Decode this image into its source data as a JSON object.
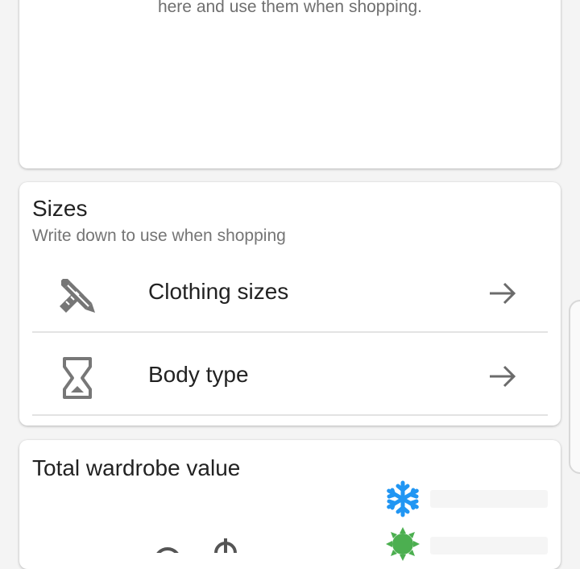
{
  "intro": {
    "text": "here and use them when shopping."
  },
  "sizes": {
    "title": "Sizes",
    "subtitle": "Write down to use when shopping",
    "items": [
      {
        "label": "Clothing sizes",
        "icon": "pencil-ruler-icon",
        "arrow_icon": "arrow-right-icon"
      },
      {
        "label": "Body type",
        "icon": "hourglass-icon",
        "arrow_icon": "arrow-right-icon"
      }
    ]
  },
  "wardrobe_value": {
    "title": "Total wardrobe value",
    "legend_icons": [
      "snowflake-icon",
      "sun-icon"
    ],
    "colors": {
      "snowflake": "#2196f3",
      "sun": "#4caf50"
    }
  }
}
